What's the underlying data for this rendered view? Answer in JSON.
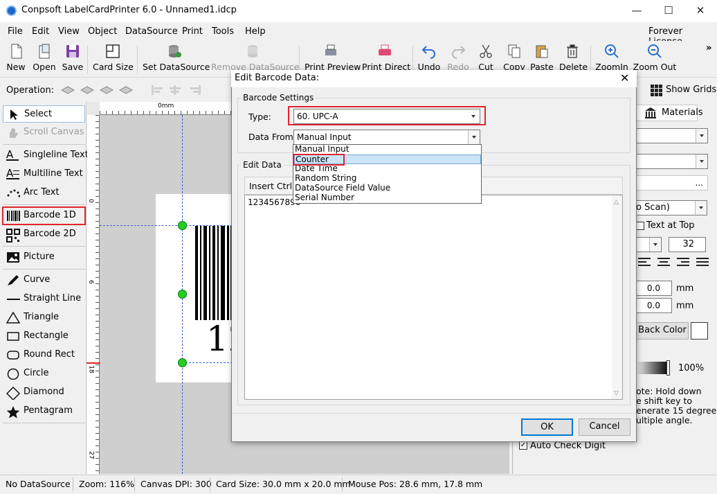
{
  "window": {
    "title": "Conpsoft LabelCardPrinter 6.0 - Unnamed1.idcp"
  },
  "menu": {
    "items": [
      "File",
      "Edit",
      "View",
      "Object",
      "DataSource",
      "Print",
      "Tools",
      "Help"
    ],
    "license": "Forever License"
  },
  "toolbar": {
    "new": "New",
    "open": "Open",
    "save": "Save",
    "card_size": "Card Size",
    "set_datasource": "Set DataSource",
    "remove_datasource": "Remove DataSource",
    "print_preview": "Print Preview",
    "print_direct": "Print Direct",
    "undo": "Undo",
    "redo": "Redo",
    "cut": "Cut",
    "copy": "Copy",
    "paste": "Paste",
    "delete": "Delete",
    "zoom_in": "ZoomIn",
    "zoom_out": "Zoom Out"
  },
  "opbar": {
    "label": "Operation:",
    "show_grids": "Show Grids"
  },
  "tools": {
    "select": "Select",
    "scroll_canvas": "Scroll Canvas",
    "singleline_text": "Singleline Text",
    "multiline_text": "Multiline Text",
    "arc_text": "Arc Text",
    "barcode_1d": "Barcode 1D",
    "barcode_2d": "Barcode 2D",
    "picture": "Picture",
    "curve": "Curve",
    "straight_line": "Straight Line",
    "triangle": "Triangle",
    "rectangle": "Rectangle",
    "round_rect": "Round Rect",
    "circle": "Circle",
    "diamond": "Diamond",
    "pentagram": "Pentagram"
  },
  "ruler": {
    "top_zero": "0mm",
    "left_marks": [
      "0",
      "6",
      "18",
      "27"
    ]
  },
  "canvas": {
    "barcode_digits": "12"
  },
  "right_panel": {
    "materials_tab": "Materials",
    "scan_option": "o Scan)",
    "text_at_top": "Text at Top",
    "font_size": "32",
    "offset_x": "0.0",
    "offset_y": "0.0",
    "unit": "mm",
    "back_color": "Back Color",
    "opacity": "100%",
    "note": "ote: Hold down\ne shift key to\nenerate 15 degree\nultiple angle.",
    "auto_check_digit": "Auto Check Digit"
  },
  "status": {
    "datasource": "No DataSource",
    "zoom": "Zoom: 116%",
    "dpi": "Canvas DPI: 300",
    "card_size": "Card Size: 30.0 mm x 20.0 mm",
    "mouse_pos": "Mouse Pos: 28.6 mm, 17.8 mm"
  },
  "dialog": {
    "title": "Edit Barcode Data:",
    "settings_group": "Barcode Settings",
    "type_label": "Type:",
    "type_value": "60.  UPC-A",
    "data_from_label": "Data From:",
    "data_from_value": "Manual Input",
    "dropdown_options": [
      "Manual Input",
      "Counter",
      "Date Time",
      "Random String",
      "DataSource Field Value",
      "Serial Number"
    ],
    "edit_group": "Edit Data",
    "insert_ctrl": "Insert Ctrl",
    "edit_text": "1234567890",
    "ok": "OK",
    "cancel": "Cancel"
  },
  "colors": {
    "highlight": "#e0242c",
    "selection_blue": "#cce4f7"
  }
}
